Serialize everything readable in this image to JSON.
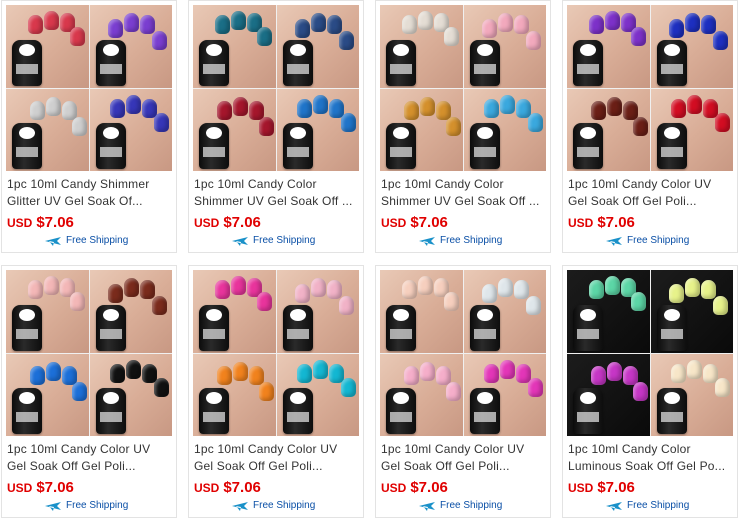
{
  "products": [
    {
      "title": "1pc 10ml Candy Shimmer Glitter UV Gel Soak Of...",
      "currency": "USD",
      "price": "$7.06",
      "shipping": "Free Shipping",
      "colors": [
        "#d8384c",
        "#7a3ed0",
        "#cfcfcf",
        "#3636b8"
      ]
    },
    {
      "title": "1pc 10ml Candy Color Shimmer UV Gel Soak Off ...",
      "currency": "USD",
      "price": "$7.06",
      "shipping": "Free Shipping",
      "colors": [
        "#1a6e86",
        "#2a4b86",
        "#a5162c",
        "#1f74c9"
      ]
    },
    {
      "title": "1pc 10ml Candy Color Shimmer UV Gel Soak Off ...",
      "currency": "USD",
      "price": "$7.06",
      "shipping": "Free Shipping",
      "colors": [
        "#e4ddd4",
        "#f2a9bd",
        "#d4902c",
        "#3aa8de"
      ]
    },
    {
      "title": "1pc 10ml Candy Color UV Gel Soak Off Gel Poli...",
      "currency": "USD",
      "price": "$7.06",
      "shipping": "Free Shipping",
      "colors": [
        "#7d31c9",
        "#1d2fc0",
        "#6b1f16",
        "#d20d22"
      ]
    },
    {
      "title": "1pc 10ml Candy Color UV Gel Soak Off Gel Poli...",
      "currency": "USD",
      "price": "$7.06",
      "shipping": "Free Shipping",
      "colors": [
        "#f3b7b7",
        "#7a2b1c",
        "#1c6fd8",
        "#111111"
      ]
    },
    {
      "title": "1pc 10ml Candy Color UV Gel Soak Off Gel Poli...",
      "currency": "USD",
      "price": "$7.06",
      "shipping": "Free Shipping",
      "colors": [
        "#e8349c",
        "#f1b2c7",
        "#f1821d",
        "#13b7d2"
      ]
    },
    {
      "title": "1pc 10ml Candy Color UV Gel Soak Off Gel Poli...",
      "currency": "USD",
      "price": "$7.06",
      "shipping": "Free Shipping",
      "colors": [
        "#f6cfbe",
        "#dfe6ea",
        "#f5aeca",
        "#e336b8"
      ]
    },
    {
      "title": "1pc 10ml Candy Color Luminous Soak Off Gel Po...",
      "currency": "USD",
      "price": "$7.06",
      "shipping": "Free Shipping",
      "colors": [
        "#5cd6a6",
        "#e7f28a",
        "#c636c6",
        "#f7e6c8"
      ]
    }
  ]
}
